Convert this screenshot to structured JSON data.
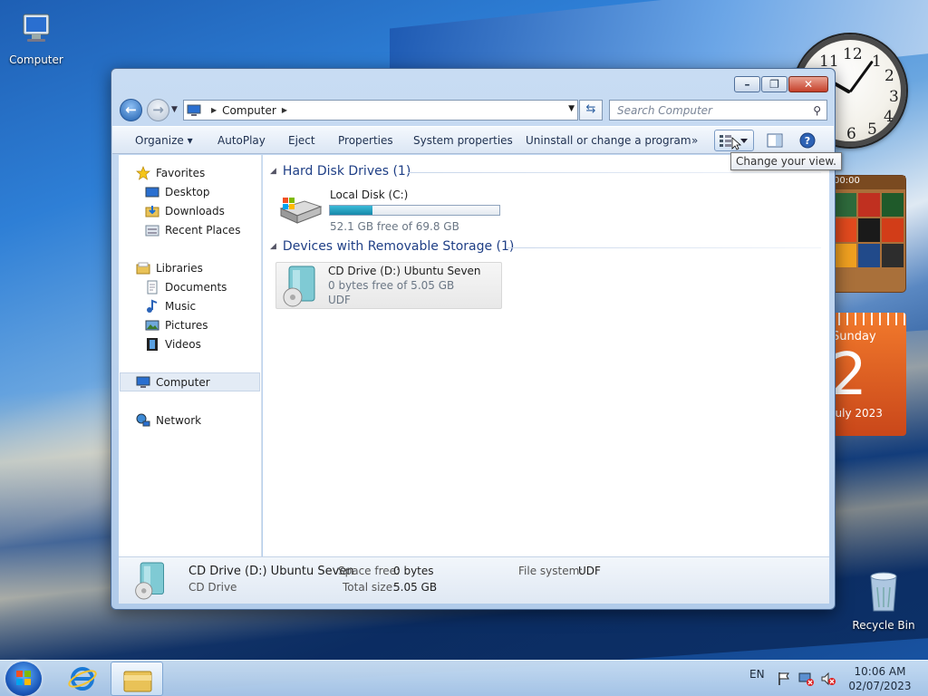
{
  "desktop": {
    "icons": [
      {
        "label": "Computer"
      },
      {
        "label": "Recycle Bin"
      }
    ]
  },
  "gadgets": {
    "clock": {
      "numerals": [
        "12",
        "1",
        "2",
        "3",
        "4",
        "5",
        "6",
        "11"
      ],
      "time": "10:06"
    },
    "puzzle": {
      "time": "00:00"
    },
    "calendar": {
      "weekday": "Sunday",
      "day": "2",
      "month_year": "July 2023"
    }
  },
  "window": {
    "address": {
      "crumb": "Computer"
    },
    "search": {
      "placeholder": "Search Computer"
    },
    "toolbar": {
      "organize": "Organize",
      "autoplay": "AutoPlay",
      "eject": "Eject",
      "properties": "Properties",
      "system_properties": "System properties",
      "uninstall": "Uninstall or change a program",
      "more": "»"
    },
    "tooltip": "Change your view.",
    "nav": {
      "favorites": "Favorites",
      "desktop": "Desktop",
      "downloads": "Downloads",
      "recent": "Recent Places",
      "libraries": "Libraries",
      "documents": "Documents",
      "music": "Music",
      "pictures": "Pictures",
      "videos": "Videos",
      "computer": "Computer",
      "network": "Network"
    },
    "groups": {
      "hdd": {
        "title": "Hard Disk Drives (1)",
        "drive": {
          "name": "Local Disk (C:)",
          "free": "52.1 GB free of 69.8 GB",
          "used_fraction": 0.25
        }
      },
      "removable": {
        "title": "Devices with Removable Storage (1)",
        "drive": {
          "name": "CD Drive (D:) Ubuntu Seven",
          "free": "0 bytes free of 5.05 GB",
          "fs": "UDF"
        }
      }
    },
    "details": {
      "name": "CD Drive (D:) Ubuntu Seven",
      "type": "CD Drive",
      "space_free_label": "Space free:",
      "space_free": "0 bytes",
      "total_size_label": "Total size:",
      "total_size": "5.05 GB",
      "fs_label": "File system:",
      "fs": "UDF"
    }
  },
  "taskbar": {
    "language": "EN",
    "time": "10:06 AM",
    "date": "02/07/2023"
  },
  "colors": {
    "accent": "#1f3f86",
    "meter": "#1688aa"
  }
}
